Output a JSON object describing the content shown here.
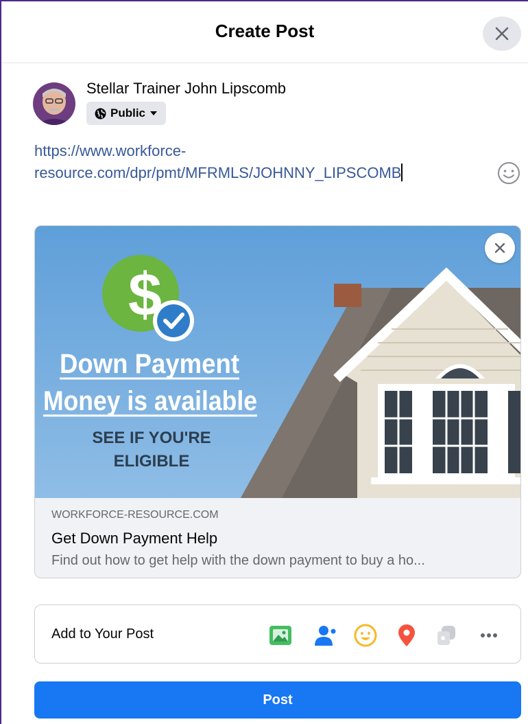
{
  "dialog": {
    "title": "Create Post",
    "close_icon": "close-icon"
  },
  "author": {
    "name": "Stellar Trainer John Lipscomb",
    "privacy_label": "Public",
    "privacy_icon": "globe-icon",
    "dropdown_icon": "caret-down-icon"
  },
  "composer": {
    "text": "https://www.workforce-resource.com/dpr/pmt/MFRMLS/JOHNNY_LIPSCOMB",
    "emoji_icon": "smiley-icon"
  },
  "link_preview": {
    "image": {
      "headline_line1": "Down Payment",
      "headline_line2": "Money is available",
      "subline_1": "SEE IF YOU'RE",
      "subline_2": "ELIGIBLE",
      "badge_symbol": "$"
    },
    "domain": "WORKFORCE-RESOURCE.COM",
    "title": "Get Down Payment Help",
    "description": "Find out how to get help with the down payment to buy a ho...",
    "remove_icon": "close-icon"
  },
  "add_to_post": {
    "label": "Add to Your Post",
    "icons": [
      "photo-video-icon",
      "tag-people-icon",
      "feeling-icon",
      "check-in-icon",
      "gif-icon",
      "more-icon"
    ]
  },
  "footer": {
    "post_label": "Post"
  },
  "colors": {
    "accent": "#1877f2",
    "link": "#385898",
    "banner_blue": "#6aa6dc",
    "badge_green": "#6bb540"
  }
}
